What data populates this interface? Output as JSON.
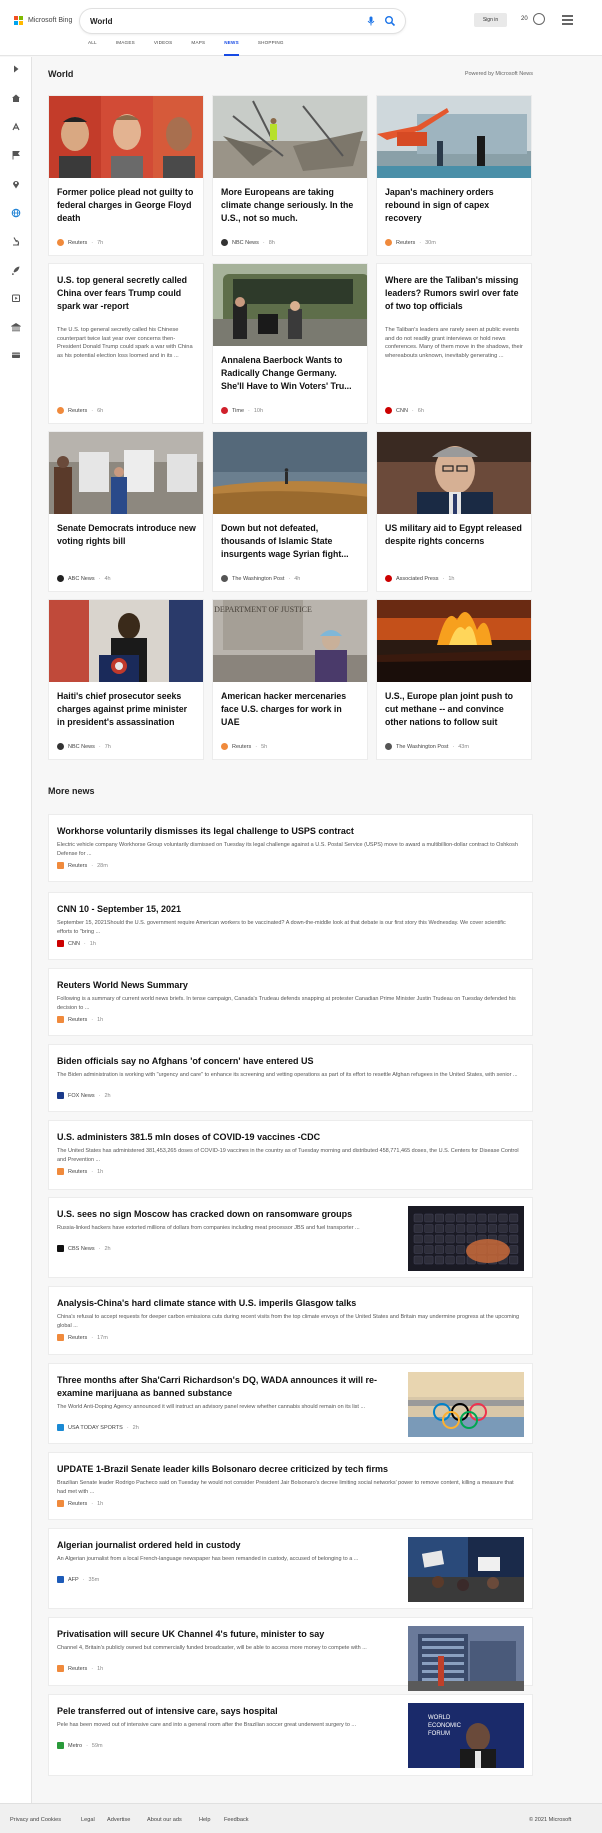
{
  "header": {
    "brand": "Microsoft Bing",
    "search_value": "World",
    "sign_in": "Sign in",
    "rewards_points": "20",
    "tabs": [
      {
        "label": "ALL",
        "active": false
      },
      {
        "label": "IMAGES",
        "active": false
      },
      {
        "label": "VIDEOS",
        "active": false
      },
      {
        "label": "MAPS",
        "active": false
      },
      {
        "label": "NEWS",
        "active": true
      },
      {
        "label": "SHOPPING",
        "active": false
      }
    ]
  },
  "rail": {
    "icons": [
      "collapse-arrow-icon",
      "home-icon",
      "headlines-icon",
      "flag-icon",
      "location-pin-icon",
      "globe-icon",
      "microscope-icon",
      "rocket-icon",
      "entertainment-icon",
      "money-icon",
      "card-icon"
    ]
  },
  "world": {
    "title": "World",
    "powered_by": "Powered by Microsoft News",
    "cards": [
      {
        "title": "Former police plead not guilty to federal charges in George Floyd death",
        "desc": "",
        "source": "Reuters",
        "time": "7h",
        "source_color": "#f08a3c",
        "image": "mugshots"
      },
      {
        "title": "More Europeans are taking climate change seriously. In the U.S., not so much.",
        "desc": "",
        "source": "NBC News",
        "time": "8h",
        "source_color": "#333333",
        "image": "storm"
      },
      {
        "title": "Japan's machinery orders rebound in sign of capex recovery",
        "desc": "",
        "source": "Reuters",
        "time": "30m",
        "source_color": "#f08a3c",
        "image": "factory"
      },
      {
        "title": "U.S. top general secretly called China over fears Trump could spark war -report",
        "desc": "The U.S. top general secretly called his Chinese counterpart twice last year over concerns then-President Donald Trump could spark a war with China as his potential election loss loomed and in its ...",
        "source": "Reuters",
        "time": "6h",
        "source_color": "#f08a3c",
        "image": ""
      },
      {
        "title": "Annalena Baerbock Wants to Radically Change Germany. She'll Have to Win Voters' Tru...",
        "desc": "",
        "source": "Time",
        "time": "10h",
        "source_color": "#d0202b",
        "image": "bus"
      },
      {
        "title": "Where are the Taliban's missing leaders? Rumors swirl over fate of two top officials",
        "desc": "The Taliban's leaders are rarely seen at public events and do not readily grant interviews or hold news conferences. Many of them move in the shadows, their whereabouts unknown, inevitably generating ...",
        "source": "CNN",
        "time": "6h",
        "source_color": "#cc0000",
        "image": ""
      },
      {
        "title": "Senate Democrats introduce new voting rights bill",
        "desc": "",
        "source": "ABC News",
        "time": "4h",
        "source_color": "#222222",
        "image": "voting"
      },
      {
        "title": "Down but not defeated, thousands of Islamic State insurgents wage Syrian fight...",
        "desc": "",
        "source": "The Washington Post",
        "time": "4h",
        "source_color": "#555555",
        "image": "desert"
      },
      {
        "title": "US military aid to Egypt released despite rights concerns",
        "desc": "",
        "source": "Associated Press",
        "time": "1h",
        "source_color": "#cc0000",
        "image": "blinken"
      },
      {
        "title": "Haiti's chief prosecutor seeks charges against prime minister in president's assassination",
        "desc": "",
        "source": "NBC News",
        "time": "7h",
        "source_color": "#333333",
        "image": "podium"
      },
      {
        "title": "American hacker mercenaries face U.S. charges for work in UAE",
        "desc": "",
        "source": "Reuters",
        "time": "5h",
        "source_color": "#f08a3c",
        "image": "justice"
      },
      {
        "title": "U.S., Europe plan joint push to cut methane -- and convince other nations to follow suit",
        "desc": "",
        "source": "The Washington Post",
        "time": "43m",
        "source_color": "#555555",
        "image": "flare"
      }
    ],
    "justice_sign": "DEPARTMENT OF JUSTICE"
  },
  "more_news": {
    "title": "More news",
    "items": [
      {
        "title": "Workhorse voluntarily dismisses its legal challenge to USPS contract",
        "desc": "Electric vehicle company Workhorse Group voluntarily dismissed on Tuesday its legal challenge against a U.S. Postal Service (USPS) move to award a multibillion-dollar contract to Oshkosh Defense for ...",
        "source": "Reuters",
        "time": "28m",
        "source_color": "#f08a3c",
        "image": ""
      },
      {
        "title": "CNN 10 - September 15, 2021",
        "desc": "September 15, 2021Should the U.S. government require American workers to be vaccinated? A down-the-middle look at that debate is our first story this Wednesday. We cover scientific efforts to \"bring ...",
        "source": "CNN",
        "time": "1h",
        "source_color": "#cc0000",
        "image": ""
      },
      {
        "title": "Reuters World News Summary",
        "desc": "Following is a summary of current world news briefs. In tense campaign, Canada's Trudeau defends snapping at protester Canadian Prime Minister Justin Trudeau on Tuesday defended his decision to ...",
        "source": "Reuters",
        "time": "1h",
        "source_color": "#f08a3c",
        "image": ""
      },
      {
        "title": "Biden officials say no Afghans 'of concern' have entered US",
        "desc": "The Biden administration is working with \"urgency and care\" to enhance its screening and vetting operations as part of its effort to resettle Afghan refugees in the United States, with senior ...",
        "source": "FOX News",
        "time": "2h",
        "source_color": "#1a3a8a",
        "image": ""
      },
      {
        "title": "U.S. administers 381.5 mln doses of COVID-19 vaccines -CDC",
        "desc": "The United States has administered 381,453,265 doses of COVID-19 vaccines in the country as of Tuesday morning and distributed 458,771,465 doses, the U.S. Centers for Disease Control and Prevention ...",
        "source": "Reuters",
        "time": "1h",
        "source_color": "#f08a3c",
        "image": ""
      },
      {
        "title": "U.S. sees no sign Moscow has cracked down on ransomware groups",
        "desc": "Russia-linked hackers have extorted millions of dollars from companies including meat processor JBS and fuel transporter ...",
        "source": "CBS News",
        "time": "2h",
        "source_color": "#111111",
        "image": "keyboard"
      },
      {
        "title": "Analysis-China's hard climate stance with U.S. imperils Glasgow talks",
        "desc": "China's refusal to accept requests for deeper carbon emissions cuts during recent visits from the top climate envoys of the United States and Britain may undermine progress at the upcoming global ...",
        "source": "Reuters",
        "time": "17m",
        "source_color": "#f08a3c",
        "image": ""
      },
      {
        "title": "Three months after Sha'Carri Richardson's DQ, WADA announces it will re-examine marijuana as banned substance",
        "desc": "The World Anti-Doping Agency announced it will instruct an advisory panel review whether cannabis should remain on its list ...",
        "source": "USA TODAY SPORTS",
        "time": "2h",
        "source_color": "#1a8ad4",
        "image": "olympic"
      },
      {
        "title": "UPDATE 1-Brazil Senate leader kills Bolsonaro decree criticized by tech firms",
        "desc": "Brazilian Senate leader Rodrigo Pacheco said on Tuesday he would not consider President Jair Bolsonaro's decree limiting social networks' power to remove content, killing a measure that had met with ...",
        "source": "Reuters",
        "time": "1h",
        "source_color": "#f08a3c",
        "image": ""
      },
      {
        "title": "Algerian journalist ordered held in custody",
        "desc": "An Algerian journalist from a local French-language newspaper has been remanded in custody, accused of belonging to a ...",
        "source": "AFP",
        "time": "35m",
        "source_color": "#1d5bb8",
        "image": "protest"
      },
      {
        "title": "Privatisation will secure UK Channel 4's future, minister to say",
        "desc": "Channel 4, Britain's publicly owned but commercially funded broadcaster, will be able to access more money to compete with ...",
        "source": "Reuters",
        "time": "1h",
        "source_color": "#f08a3c",
        "image": "building"
      },
      {
        "title": "Pele transferred out of intensive care, says hospital",
        "desc": "Pele has been moved out of intensive care and into a general room after the Brazilian soccer great underwent surgery to ...",
        "source": "Metro",
        "time": "59m",
        "source_color": "#2a9a3a",
        "image": "pele"
      }
    ],
    "forum_text": [
      "WORLD",
      "ECONOMIC",
      "FORUM"
    ]
  },
  "footer": {
    "links": [
      "Privacy and Cookies",
      "Legal",
      "Advertise",
      "About our ads",
      "Help",
      "Feedback"
    ],
    "copyright": "© 2021 Microsoft"
  },
  "colors": {
    "accent": "#174ae4",
    "active_rail": "#1a7fd4"
  }
}
